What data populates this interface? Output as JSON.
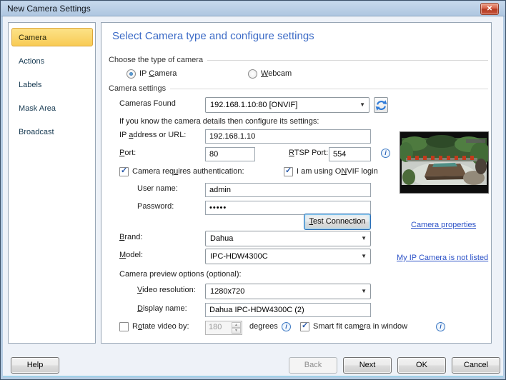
{
  "window": {
    "title": "New Camera Settings"
  },
  "icons": {
    "close": "✕",
    "dropdown": "▼",
    "check": "✓",
    "spin_up": "▲",
    "spin_down": "▼",
    "info": "i",
    "refresh": "refresh-arrows"
  },
  "colors": {
    "heading_blue": "#3b6ac6",
    "link_blue": "#2b51c7",
    "selected_item_yellow": "#f8cb55",
    "close_red": "#b33a20",
    "titlebar_blue": "#aec6e0"
  },
  "sidebar": {
    "items": [
      {
        "label": "Camera",
        "selected": true
      },
      {
        "label": "Actions",
        "selected": false
      },
      {
        "label": "Labels",
        "selected": false
      },
      {
        "label": "Mask Area",
        "selected": false
      },
      {
        "label": "Broadcast",
        "selected": false
      }
    ]
  },
  "main": {
    "heading": "Select Camera type and configure settings",
    "type_group": {
      "label": "Choose the type of camera",
      "ip_camera": {
        "text": "IP Camera",
        "accel": 3,
        "selected": true
      },
      "webcam": {
        "text": "Webcam",
        "accel": 0,
        "selected": false
      }
    },
    "settings_group": {
      "label": "Camera settings",
      "cameras_found_label": "Cameras Found",
      "cameras_found_value": "192.168.1.10:80 [ONVIF]",
      "details_hint": "If you know the camera details then configure its settings:",
      "ip_label": {
        "text": "IP address or URL:",
        "accel": 3
      },
      "ip_value": "192.168.1.10",
      "port_label": {
        "text": "Port:",
        "accel": 0
      },
      "port_value": "80",
      "rtsp_label": {
        "text": "RTSP Port:",
        "accel": 0
      },
      "rtsp_value": "554",
      "auth_checkbox": {
        "text": "Camera requires authentication:",
        "accel": 10,
        "checked": true
      },
      "onvif_checkbox": {
        "text": "I am using ONVIF login",
        "accel": 12,
        "checked": true
      },
      "username_label": "User name:",
      "username_value": "admin",
      "password_label": "Password:",
      "password_value": "•••••",
      "test_button": {
        "text": "Test Connection",
        "accel": 0
      },
      "brand_label": {
        "text": "Brand:",
        "accel": 0
      },
      "brand_value": "Dahua",
      "model_label": {
        "text": "Model:",
        "accel": 0
      },
      "model_value": "IPC-HDW4300C",
      "preview_options_label": "Camera preview options (optional):",
      "video_resolution_label": {
        "text": "Video resolution:",
        "accel": 0
      },
      "video_resolution_value": "1280x720",
      "display_name_label": {
        "text": "Display name:",
        "accel": 0
      },
      "display_name_value": "Dahua IPC-HDW4300C (2)",
      "rotate_checkbox": {
        "text": "Rotate video by:",
        "accel": 1,
        "checked": false
      },
      "rotate_value": "180",
      "rotate_unit": "degrees",
      "smart_fit_checkbox": {
        "text": "Smart fit camera in window",
        "accel": 13,
        "checked": true
      }
    },
    "links": {
      "camera_properties": "Camera properties",
      "not_listed": "My IP Camera is not listed"
    }
  },
  "footer": {
    "help": "Help",
    "back": "Back",
    "next": "Next",
    "ok": "OK",
    "cancel": "Cancel"
  }
}
